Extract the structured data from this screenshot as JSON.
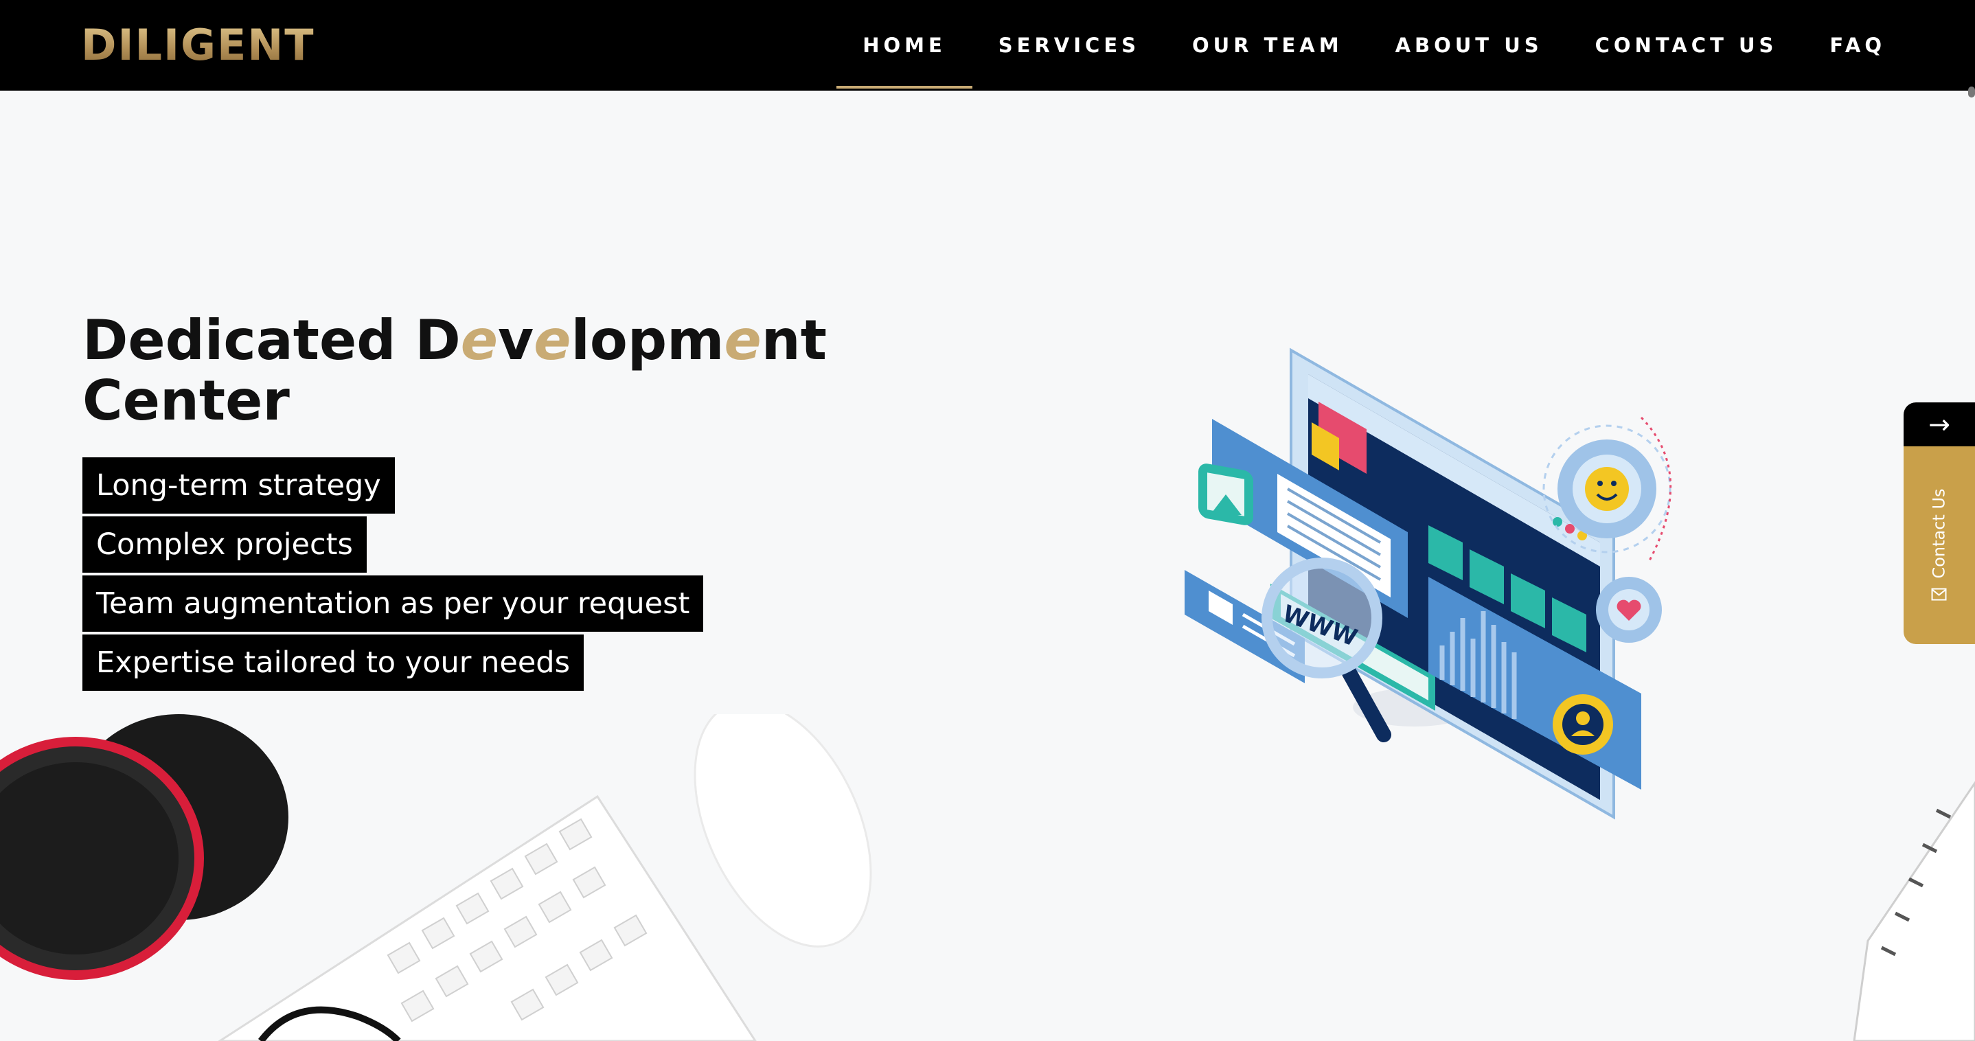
{
  "header": {
    "logo_text": "DILIGENT",
    "nav": [
      {
        "label": "HOME",
        "active": true
      },
      {
        "label": "SERVICES",
        "active": false
      },
      {
        "label": "OUR TEAM",
        "active": false
      },
      {
        "label": "ABOUT US",
        "active": false
      },
      {
        "label": "CONTACT US",
        "active": false
      },
      {
        "label": "FAQ",
        "active": false
      }
    ]
  },
  "hero": {
    "title_part1": "Dedicated ",
    "title_bold_segments": [
      "D",
      "e",
      "v",
      "e",
      "lopm",
      "e",
      "nt"
    ],
    "title_part2": "Center",
    "bullets": [
      "Long-term strategy",
      "Complex projects",
      "Team augmentation as per your request",
      "Expertise tailored to your needs"
    ]
  },
  "side_tab": {
    "arrow": "→",
    "label": "Contact Us"
  },
  "illustration": {
    "magnifier_text": "WWW"
  },
  "colors": {
    "brand_gold": "#c9ab74",
    "tab_gold": "#c9a04a",
    "header_bg": "#000000",
    "page_bg": "#f7f8f9"
  },
  "icons": [
    "arrow-right-icon",
    "envelope-icon",
    "gear-icon",
    "smiley-icon",
    "heart-icon",
    "image-icon",
    "chat-icon",
    "magnifier-icon",
    "user-icon"
  ]
}
